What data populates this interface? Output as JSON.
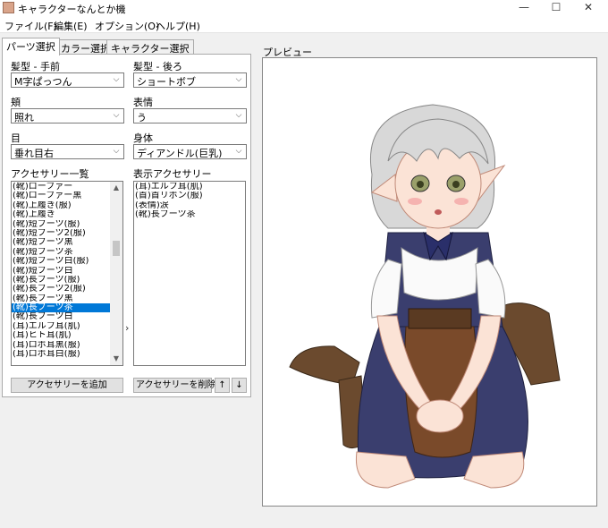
{
  "window": {
    "title": "キャラクターなんとか機",
    "minimize": "—",
    "maximize": "☐",
    "close": "✕"
  },
  "menu": [
    "ファイル(F)",
    "編集(E)",
    "オプション(O)",
    "ヘルプ(H)"
  ],
  "tabs": [
    "パーツ選択",
    "カラー選択",
    "キャラクター選択"
  ],
  "parts": {
    "hair_front": {
      "label": "髪型 - 手前",
      "value": "M字ぱっつん"
    },
    "hair_back": {
      "label": "髪型 - 後ろ",
      "value": "ショートボブ"
    },
    "cheek": {
      "label": "頬",
      "value": "照れ"
    },
    "expression": {
      "label": "表情",
      "value": "う"
    },
    "eyes": {
      "label": "目",
      "value": "垂れ目右"
    },
    "body": {
      "label": "身体",
      "value": "ディアンドル(巨乳)"
    }
  },
  "accessory_list": {
    "label": "アクセサリー一覧",
    "items": [
      "(靴)ローファー",
      "(靴)ローファー黒",
      "(靴)上履き(服)",
      "(靴)上履き",
      "(靴)短ブーツ(服)",
      "(靴)短ブーツ2(服)",
      "(靴)短ブーツ黒",
      "(靴)短ブーツ茶",
      "(靴)短ブーツ白(服)",
      "(靴)短ブーツ白",
      "(靴)長ブーツ(服)",
      "(靴)長ブーツ2(服)",
      "(靴)長ブーツ黒",
      "(靴)長ブーツ茶",
      "(靴)長ブーツ白",
      "(耳)エルフ耳(肌)",
      "(耳)ヒト耳(肌)",
      "(耳)ロボ耳黒(服)",
      "(耳)ロボ耳白(服)"
    ],
    "selected": "(靴)長ブーツ茶"
  },
  "display_accessories": {
    "label": "表示アクセサリー",
    "items": [
      "(耳)エルフ耳(肌)",
      "(首)首リボン(服)",
      "(表情)涙",
      "(靴)長ブーツ茶"
    ]
  },
  "buttons": {
    "add_accessory": "アクセサリーを追加",
    "remove_accessory": "アクセサリーを削除",
    "move_up": "↑",
    "move_down": "↓",
    "transfer": "›"
  },
  "preview": {
    "label": "プレビュー"
  },
  "colors": {
    "selection": "#0078d7",
    "hair": "#d8d8d8",
    "dress": "#3a3e6e",
    "apron": "#7a4a2a",
    "boots": "#6b4a2e",
    "skin": "#fbe3d6",
    "ribbon": "#2a2f6a"
  },
  "icons": [
    "app-icon",
    "chevron-down-icon",
    "scroll-up-icon",
    "scroll-down-icon",
    "transfer-arrow-icon"
  ]
}
